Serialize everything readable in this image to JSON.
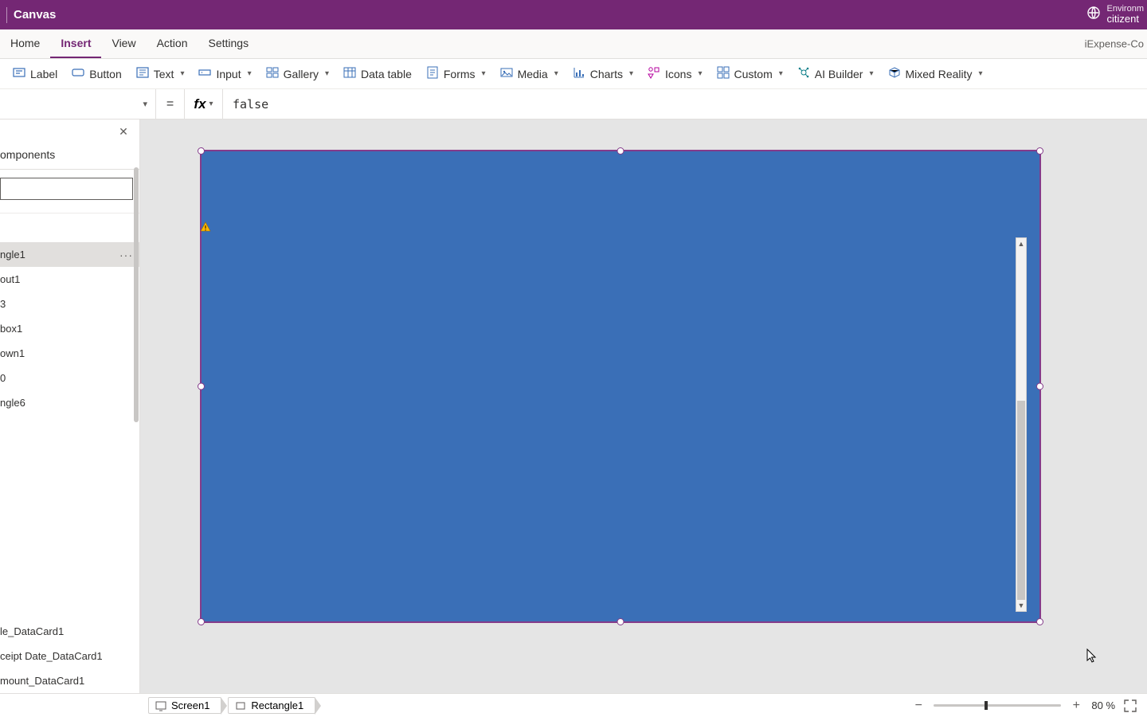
{
  "titlebar": {
    "title": "Canvas",
    "env_label": "Environm",
    "env_name": "citizent"
  },
  "menubar": {
    "tabs": [
      "Home",
      "Insert",
      "View",
      "Action",
      "Settings"
    ],
    "active_index": 1,
    "app_name": "iExpense-Co"
  },
  "ribbon": {
    "items": [
      {
        "label": "Label",
        "chev": false
      },
      {
        "label": "Button",
        "chev": false
      },
      {
        "label": "Text",
        "chev": true
      },
      {
        "label": "Input",
        "chev": true
      },
      {
        "label": "Gallery",
        "chev": true
      },
      {
        "label": "Data table",
        "chev": false
      },
      {
        "label": "Forms",
        "chev": true
      },
      {
        "label": "Media",
        "chev": true
      },
      {
        "label": "Charts",
        "chev": true
      },
      {
        "label": "Icons",
        "chev": true
      },
      {
        "label": "Custom",
        "chev": true
      },
      {
        "label": "AI Builder",
        "chev": true
      },
      {
        "label": "Mixed Reality",
        "chev": true
      }
    ]
  },
  "formula": {
    "value": "false"
  },
  "tree": {
    "tab_label": "omponents",
    "search_value": "",
    "items": [
      "ngle1",
      "out1",
      "3",
      "box1",
      "own1",
      "0",
      "ngle6"
    ],
    "selected_index": 0,
    "bottom_items": [
      "le_DataCard1",
      "ceipt Date_DataCard1",
      "mount_DataCard1"
    ]
  },
  "breadcrumb": {
    "screen": "Screen1",
    "control": "Rectangle1"
  },
  "zoom": {
    "value": "80",
    "unit": "%"
  },
  "colors": {
    "brand": "#742774",
    "shape": "#3a6fb7"
  }
}
